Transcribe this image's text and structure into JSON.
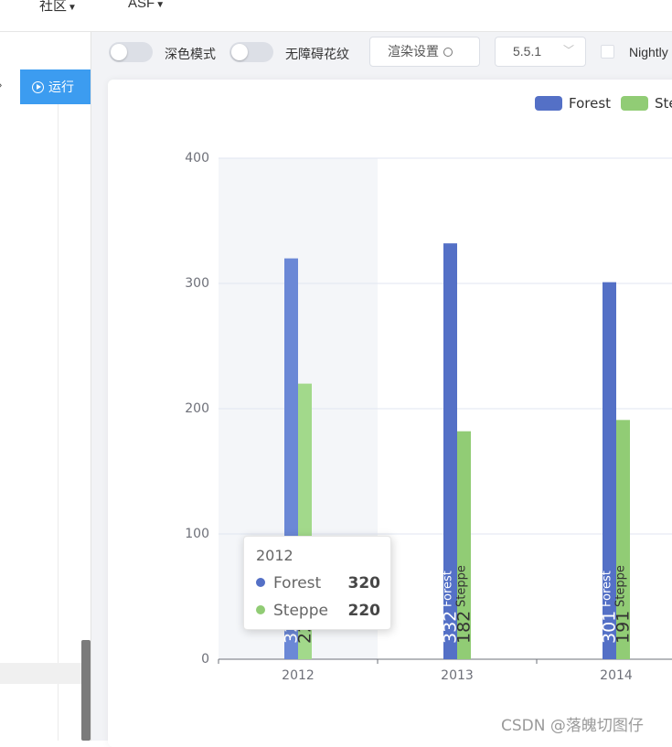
{
  "topnav": {
    "community_label": "社区",
    "asf_label": "ASF"
  },
  "editor": {
    "run_label": "运行",
    "collapse_icon": "chevron-right-icon"
  },
  "toolbar": {
    "dark_mode_label": "深色模式",
    "decal_label": "无障碍花纹",
    "render_settings_label": "渲染设置",
    "version_value": "5.5.1",
    "nightly_label": "Nightly"
  },
  "chart_data": {
    "type": "bar",
    "categories": [
      "2012",
      "2013",
      "2014"
    ],
    "series": [
      {
        "name": "Forest",
        "values": [
          320,
          332,
          301
        ],
        "color": "#5470c6"
      },
      {
        "name": "Steppe",
        "values": [
          220,
          182,
          191
        ],
        "color": "#91cc75"
      }
    ],
    "legend": [
      "Forest",
      "Ste"
    ],
    "legend_position": "top-right",
    "ylim": [
      0,
      400
    ],
    "yticks": [
      0,
      100,
      200,
      300,
      400
    ],
    "grid": true,
    "highlighted_category": "2012",
    "label_rotation": 90
  },
  "tooltip": {
    "title": "2012",
    "rows": [
      {
        "name": "Forest",
        "value": "320",
        "color": "#5470c6"
      },
      {
        "name": "Steppe",
        "value": "220",
        "color": "#91cc75"
      }
    ]
  },
  "watermark": "CSDN @落魄切图仔"
}
